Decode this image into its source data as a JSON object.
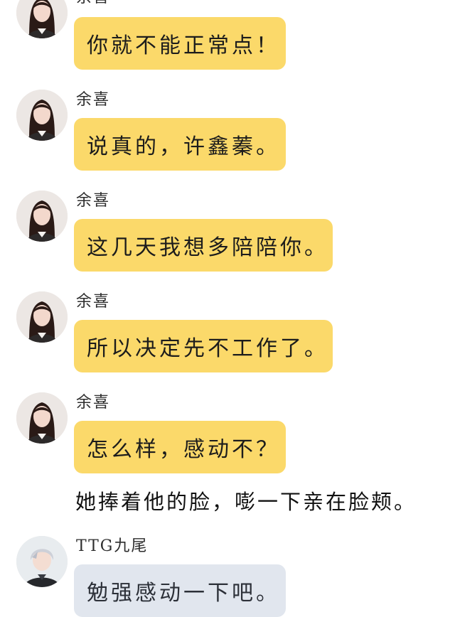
{
  "messages": [
    {
      "sender": "余喜",
      "text": "你就不能正常点！"
    },
    {
      "sender": "余喜",
      "text": "说真的，许鑫蓁。"
    },
    {
      "sender": "余喜",
      "text": "这几天我想多陪陪你。"
    },
    {
      "sender": "余喜",
      "text": "所以决定先不工作了。"
    },
    {
      "sender": "余喜",
      "text": "怎么样，感动不？"
    }
  ],
  "narration": "她捧着他的脸，嘭一下亲在脸颊。",
  "reply": {
    "sender": "TTG九尾",
    "text": "勉强感动一下吧。"
  },
  "colors": {
    "bubble_yellow": "#fbd96a",
    "bubble_grey": "#e1e6ee"
  }
}
